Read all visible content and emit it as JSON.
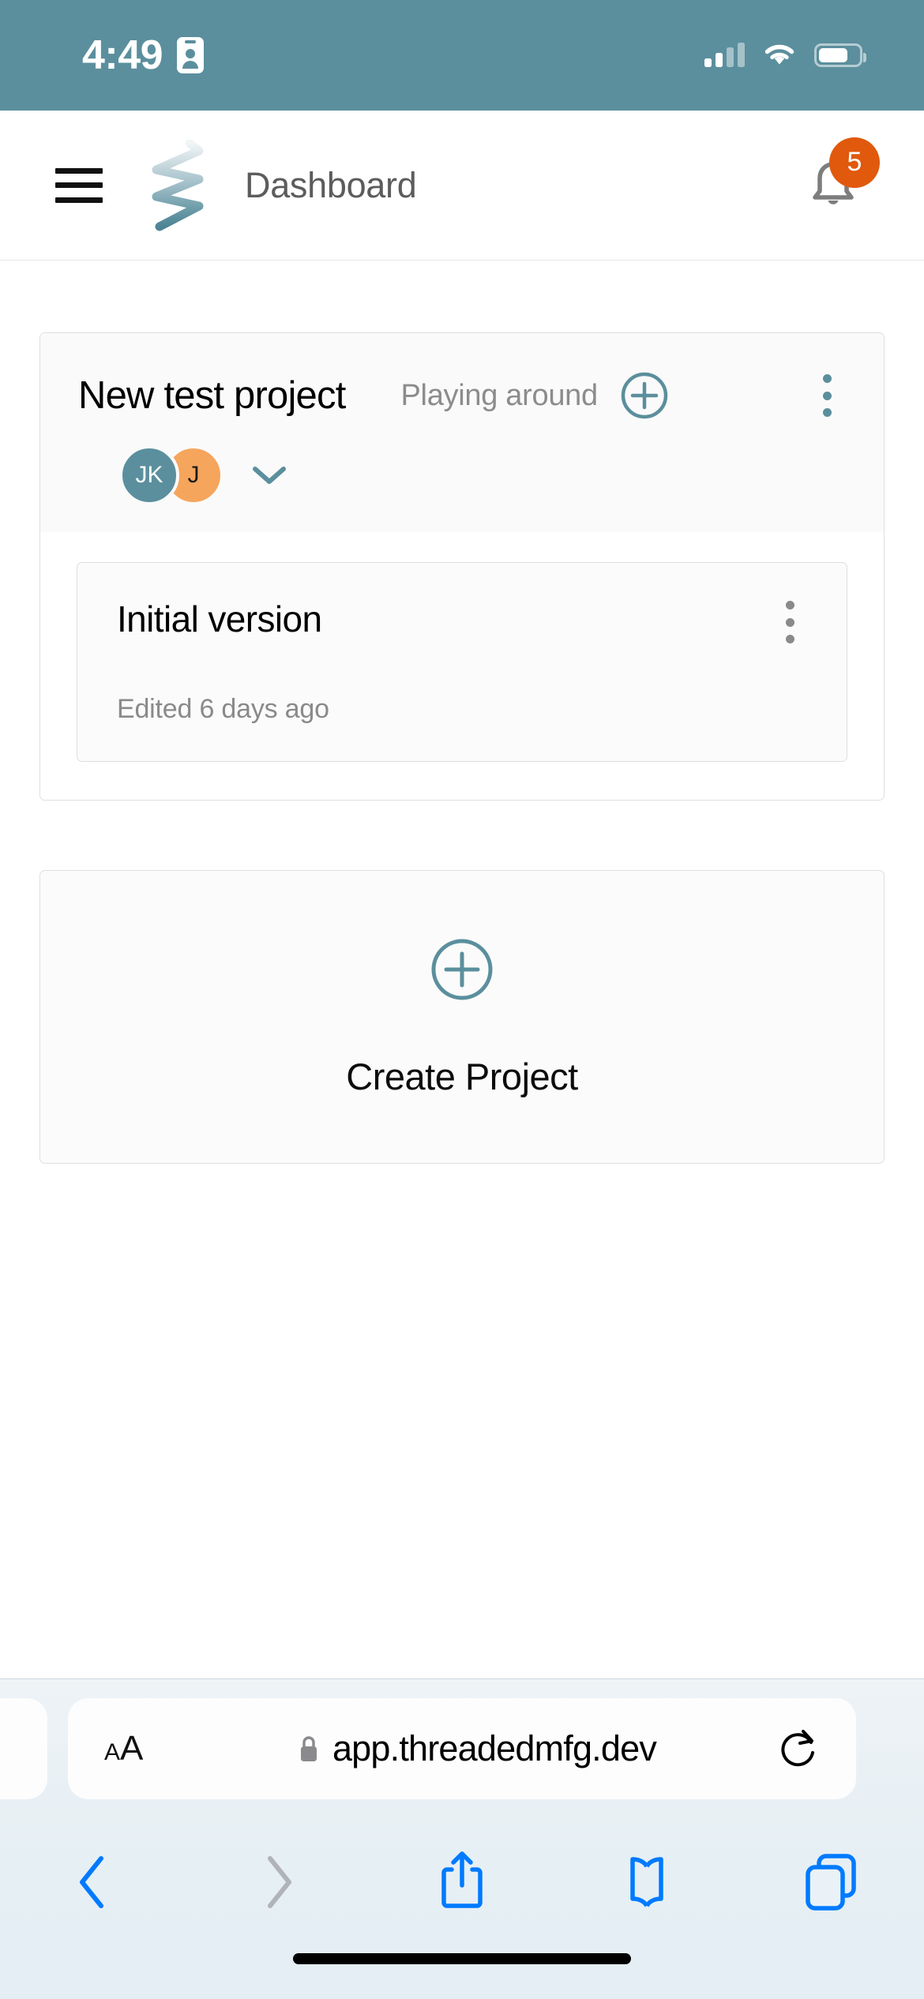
{
  "status_bar": {
    "time": "4:49",
    "icons": [
      "id-card-icon",
      "cellular-signal-icon",
      "wifi-icon",
      "battery-icon"
    ],
    "battery_level_pct": 65,
    "signal_bars_filled": 2,
    "background_color": "#5b8f9d"
  },
  "app_header": {
    "menu_label": "menu",
    "logo_name": "threaded-mfg-logo",
    "title": "Dashboard",
    "notifications": {
      "icon": "bell-icon",
      "badge_count": "5",
      "badge_color": "#e0590d"
    }
  },
  "main": {
    "projects": [
      {
        "name": "New test project",
        "subtitle": "Playing around",
        "add_icon": "plus-circle-icon",
        "menu_icon": "kebab-menu-icon",
        "members": [
          {
            "initials": "JK",
            "color": "#5b8f9d"
          },
          {
            "initials": "J",
            "color": "#f6a55c"
          }
        ],
        "expand_icon": "chevron-down-icon",
        "versions": [
          {
            "title": "Initial version",
            "meta": "Edited 6 days ago",
            "menu_icon": "kebab-menu-icon"
          }
        ]
      }
    ],
    "create_project": {
      "icon": "plus-circle-icon",
      "label": "Create Project"
    }
  },
  "browser": {
    "text_size_button": {
      "small_a": "A",
      "large_a": "A"
    },
    "url": "app.threadedmfg.dev",
    "secure_icon": "lock-icon",
    "reload_icon": "reload-icon",
    "toolbar": [
      {
        "name": "back-button",
        "icon": "chevron-left-icon",
        "enabled": true
      },
      {
        "name": "forward-button",
        "icon": "chevron-right-icon",
        "enabled": false
      },
      {
        "name": "share-button",
        "icon": "share-icon",
        "enabled": true
      },
      {
        "name": "bookmarks-button",
        "icon": "book-icon",
        "enabled": true
      },
      {
        "name": "tabs-button",
        "icon": "tabs-icon",
        "enabled": true
      }
    ],
    "accent_color": "#007aff",
    "disabled_color": "#b0b3b8"
  }
}
